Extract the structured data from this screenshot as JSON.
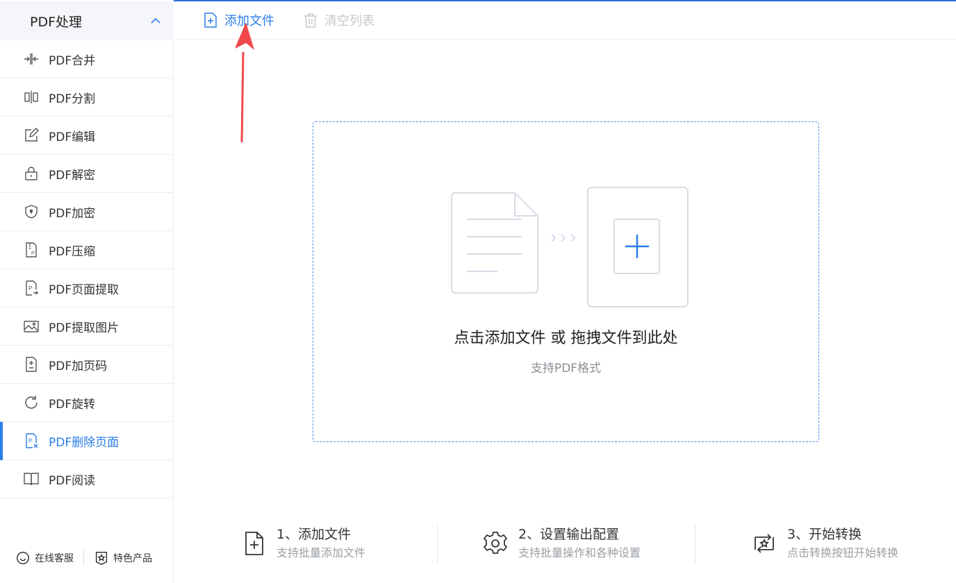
{
  "sidebar": {
    "header": "PDF处理",
    "items": [
      {
        "label": "PDF合并",
        "icon": "merge-icon"
      },
      {
        "label": "PDF分割",
        "icon": "split-icon"
      },
      {
        "label": "PDF编辑",
        "icon": "edit-icon"
      },
      {
        "label": "PDF解密",
        "icon": "unlock-icon"
      },
      {
        "label": "PDF加密",
        "icon": "shield-lock-icon"
      },
      {
        "label": "PDF压缩",
        "icon": "compress-icon"
      },
      {
        "label": "PDF页面提取",
        "icon": "page-extract-icon"
      },
      {
        "label": "PDF提取图片",
        "icon": "image-extract-icon"
      },
      {
        "label": "PDF加页码",
        "icon": "page-number-icon"
      },
      {
        "label": "PDF旋转",
        "icon": "rotate-icon"
      },
      {
        "label": "PDF删除页面",
        "icon": "delete-page-icon",
        "active": true
      },
      {
        "label": "PDF阅读",
        "icon": "book-icon"
      }
    ],
    "footer": {
      "service": "在线客服",
      "products": "特色产品"
    }
  },
  "toolbar": {
    "add_label": "添加文件",
    "clear_label": "清空列表"
  },
  "dropzone": {
    "main_text": "点击添加文件 或 拖拽文件到此处",
    "sub_text": "支持PDF格式"
  },
  "steps": [
    {
      "title": "1、添加文件",
      "desc": "支持批量添加文件",
      "icon": "add-file-icon"
    },
    {
      "title": "2、设置输出配置",
      "desc": "支持批量操作和各种设置",
      "icon": "gear-icon"
    },
    {
      "title": "3、开始转换",
      "desc": "点击转换按钮开始转换",
      "icon": "convert-icon"
    }
  ],
  "colors": {
    "accent": "#2b7de9",
    "annotation": "#f0484b"
  }
}
